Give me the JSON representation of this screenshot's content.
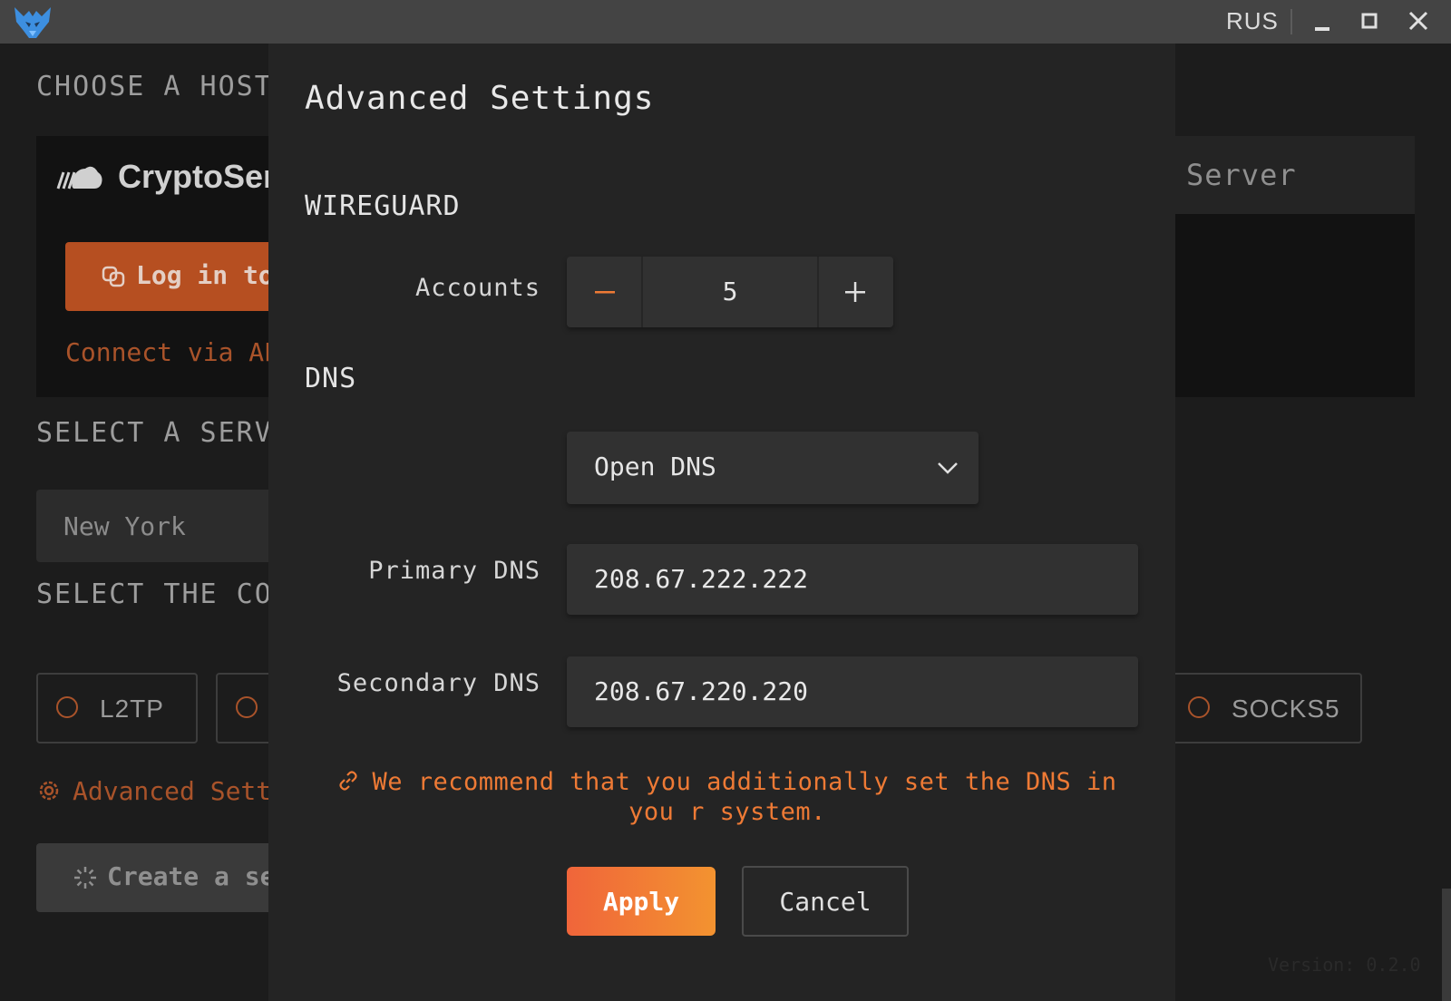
{
  "titlebar": {
    "language": "RUS"
  },
  "background": {
    "hosting_heading": "CHOOSE A HOSTI",
    "provider_name": "CryptoSer",
    "login_button": "Log in to",
    "connect_api_link": "Connect via AP",
    "server_tab": "Server",
    "server_heading": "SELECT A SERVE",
    "city_value": "New York",
    "connection_heading": "SELECT THE CON",
    "protocols": [
      "L2TP",
      "SOCKS5"
    ],
    "advanced_link": "Advanced Sett",
    "create_button": "Create a se",
    "version": "Version: 0.2.0"
  },
  "modal": {
    "title": "Advanced Settings",
    "wireguard_section": "WIREGUARD",
    "accounts_label": "Accounts",
    "accounts_value": "5",
    "dns_section": "DNS",
    "dns_provider": "Open DNS",
    "primary_dns_label": "Primary DNS",
    "primary_dns_value": "208.67.222.222",
    "secondary_dns_label": "Secondary DNS",
    "secondary_dns_value": "208.67.220.220",
    "warning": "We recommend that you additionally set the DNS in you r system.",
    "apply_label": "Apply",
    "cancel_label": "Cancel"
  },
  "colors": {
    "accent": "#f07a35",
    "accent_dark": "#b64f21",
    "modal_bg": "#242424",
    "input_bg": "#313131"
  },
  "icons": [
    "app-logo-icon",
    "minimize-icon",
    "maximize-icon",
    "close-icon",
    "minus-icon",
    "plus-icon",
    "chevron-down-icon",
    "link-icon",
    "gear-icon",
    "spinner-icon",
    "cloud-icon"
  ]
}
